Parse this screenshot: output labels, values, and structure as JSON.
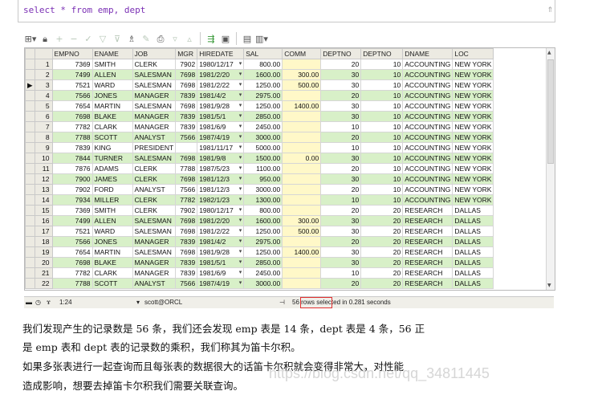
{
  "editor": {
    "sql": "select * from emp, dept",
    "scroll_icon": "chevron-up-icon"
  },
  "toolbar": {
    "icons": [
      "grid-menu-icon",
      "lock-icon",
      "add-record-icon",
      "delete-record-icon",
      "post-edit-icon",
      "filter-icon",
      "clear-filter-icon",
      "find-icon",
      "eraser-icon",
      "print-icon",
      "query-by-example-icon",
      "next-page-icon",
      "previous-page-icon",
      "export-icon",
      "save-icon",
      "record-view-icon",
      "chart-icon"
    ]
  },
  "grid": {
    "columns": [
      "EMPNO",
      "ENAME",
      "JOB",
      "MGR",
      "HIREDATE",
      "SAL",
      "COMM",
      "DEPTNO",
      "DEPTNO",
      "DNAME",
      "LOC"
    ],
    "current_row_marker": "▶",
    "rows": [
      [
        "1",
        "7369",
        "SMITH",
        "CLERK",
        "7902",
        "1980/12/17",
        "800.00",
        "",
        "20",
        "10",
        "ACCOUNTING",
        "NEW YORK"
      ],
      [
        "2",
        "7499",
        "ALLEN",
        "SALESMAN",
        "7698",
        "1981/2/20",
        "1600.00",
        "300.00",
        "30",
        "10",
        "ACCOUNTING",
        "NEW YORK"
      ],
      [
        "3",
        "7521",
        "WARD",
        "SALESMAN",
        "7698",
        "1981/2/22",
        "1250.00",
        "500.00",
        "30",
        "10",
        "ACCOUNTING",
        "NEW YORK"
      ],
      [
        "4",
        "7566",
        "JONES",
        "MANAGER",
        "7839",
        "1981/4/2",
        "2975.00",
        "",
        "20",
        "10",
        "ACCOUNTING",
        "NEW YORK"
      ],
      [
        "5",
        "7654",
        "MARTIN",
        "SALESMAN",
        "7698",
        "1981/9/28",
        "1250.00",
        "1400.00",
        "30",
        "10",
        "ACCOUNTING",
        "NEW YORK"
      ],
      [
        "6",
        "7698",
        "BLAKE",
        "MANAGER",
        "7839",
        "1981/5/1",
        "2850.00",
        "",
        "30",
        "10",
        "ACCOUNTING",
        "NEW YORK"
      ],
      [
        "7",
        "7782",
        "CLARK",
        "MANAGER",
        "7839",
        "1981/6/9",
        "2450.00",
        "",
        "10",
        "10",
        "ACCOUNTING",
        "NEW YORK"
      ],
      [
        "8",
        "7788",
        "SCOTT",
        "ANALYST",
        "7566",
        "1987/4/19",
        "3000.00",
        "",
        "20",
        "10",
        "ACCOUNTING",
        "NEW YORK"
      ],
      [
        "9",
        "7839",
        "KING",
        "PRESIDENT",
        "",
        "1981/11/17",
        "5000.00",
        "",
        "10",
        "10",
        "ACCOUNTING",
        "NEW YORK"
      ],
      [
        "10",
        "7844",
        "TURNER",
        "SALESMAN",
        "7698",
        "1981/9/8",
        "1500.00",
        "0.00",
        "30",
        "10",
        "ACCOUNTING",
        "NEW YORK"
      ],
      [
        "11",
        "7876",
        "ADAMS",
        "CLERK",
        "7788",
        "1987/5/23",
        "1100.00",
        "",
        "20",
        "10",
        "ACCOUNTING",
        "NEW YORK"
      ],
      [
        "12",
        "7900",
        "JAMES",
        "CLERK",
        "7698",
        "1981/12/3",
        "950.00",
        "",
        "30",
        "10",
        "ACCOUNTING",
        "NEW YORK"
      ],
      [
        "13",
        "7902",
        "FORD",
        "ANALYST",
        "7566",
        "1981/12/3",
        "3000.00",
        "",
        "20",
        "10",
        "ACCOUNTING",
        "NEW YORK"
      ],
      [
        "14",
        "7934",
        "MILLER",
        "CLERK",
        "7782",
        "1982/1/23",
        "1300.00",
        "",
        "10",
        "10",
        "ACCOUNTING",
        "NEW YORK"
      ],
      [
        "15",
        "7369",
        "SMITH",
        "CLERK",
        "7902",
        "1980/12/17",
        "800.00",
        "",
        "20",
        "20",
        "RESEARCH",
        "DALLAS"
      ],
      [
        "16",
        "7499",
        "ALLEN",
        "SALESMAN",
        "7698",
        "1981/2/20",
        "1600.00",
        "300.00",
        "30",
        "20",
        "RESEARCH",
        "DALLAS"
      ],
      [
        "17",
        "7521",
        "WARD",
        "SALESMAN",
        "7698",
        "1981/2/22",
        "1250.00",
        "500.00",
        "30",
        "20",
        "RESEARCH",
        "DALLAS"
      ],
      [
        "18",
        "7566",
        "JONES",
        "MANAGER",
        "7839",
        "1981/4/2",
        "2975.00",
        "",
        "20",
        "20",
        "RESEARCH",
        "DALLAS"
      ],
      [
        "19",
        "7654",
        "MARTIN",
        "SALESMAN",
        "7698",
        "1981/9/28",
        "1250.00",
        "1400.00",
        "30",
        "20",
        "RESEARCH",
        "DALLAS"
      ],
      [
        "20",
        "7698",
        "BLAKE",
        "MANAGER",
        "7839",
        "1981/5/1",
        "2850.00",
        "",
        "30",
        "20",
        "RESEARCH",
        "DALLAS"
      ],
      [
        "21",
        "7782",
        "CLARK",
        "MANAGER",
        "7839",
        "1981/6/9",
        "2450.00",
        "",
        "10",
        "20",
        "RESEARCH",
        "DALLAS"
      ],
      [
        "22",
        "7788",
        "SCOTT",
        "ANALYST",
        "7566",
        "1987/4/19",
        "3000.00",
        "",
        "20",
        "20",
        "RESEARCH",
        "DALLAS"
      ]
    ]
  },
  "status": {
    "position": "1:24",
    "connection": "scott@ORCL",
    "rows_message": "56 rows selected in 0.281 seconds"
  },
  "text": {
    "line1": "我们发现产生的记录数是 56 条，我们还会发现 emp 表是 14 条，dept 表是 4 条，56 正",
    "line2": "是 emp 表和 dept 表的记录数的乘积，我们称其为笛卡尔积。",
    "line3": "如果多张表进行一起查询而且每张表的数据很大的话笛卡尔积就会变得非常大，对性能",
    "line4": "造成影响，想要去掉笛卡尔积我们需要关联查询。"
  },
  "watermark": "https://blog.csdn.net/qq_34811445"
}
